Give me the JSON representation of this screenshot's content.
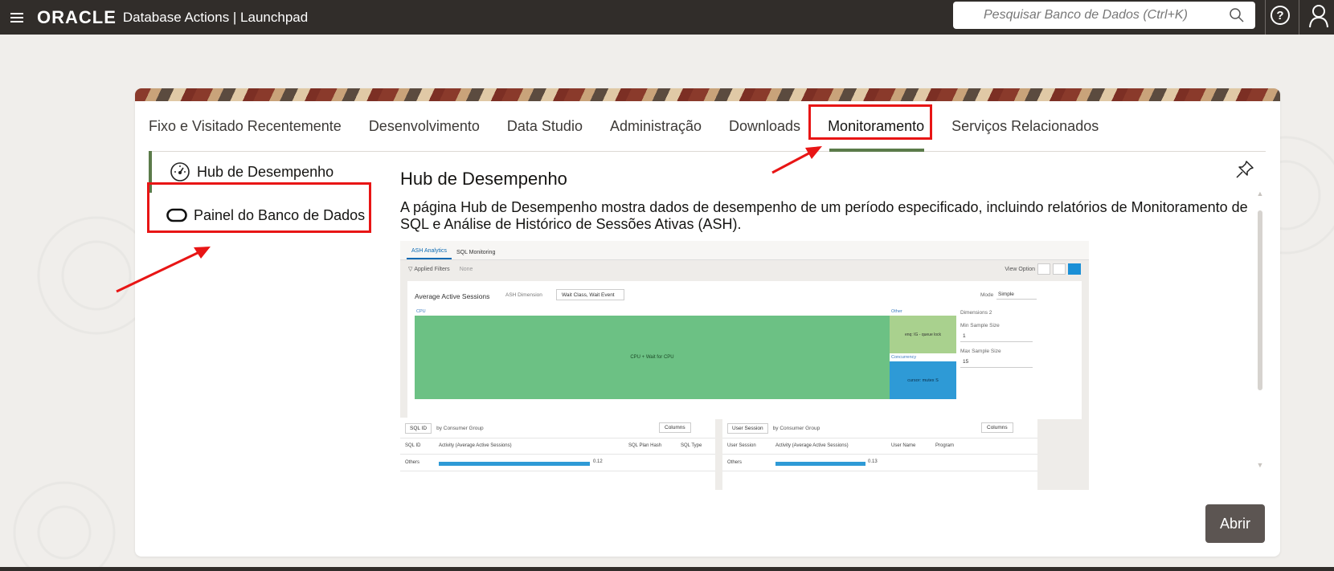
{
  "topbar": {
    "brand": "ORACLE",
    "app_title": "Database Actions | Launchpad",
    "search_placeholder": "Pesquisar Banco de Dados (Ctrl+K)",
    "help_label": "?"
  },
  "tabs": [
    {
      "label": "Fixo e Visitado Recentemente",
      "active": false
    },
    {
      "label": "Desenvolvimento",
      "active": false
    },
    {
      "label": "Data Studio",
      "active": false
    },
    {
      "label": "Administração",
      "active": false
    },
    {
      "label": "Downloads",
      "active": false
    },
    {
      "label": "Monitoramento",
      "active": true
    },
    {
      "label": "Serviços Relacionados",
      "active": false
    }
  ],
  "left_items": [
    {
      "label": "Hub de Desempenho",
      "icon": "gauge-icon",
      "selected": true
    },
    {
      "label": "Painel do Banco de Dados",
      "icon": "oval-icon",
      "selected": false
    }
  ],
  "content": {
    "title": "Hub de Desempenho",
    "description": "A página Hub de Desempenho mostra dados de desempenho de um período especificado, incluindo relatórios de Monitoramento de SQL e Análise de Histórico de Sessões Ativas (ASH)."
  },
  "preview": {
    "tabs": [
      "ASH Analytics",
      "SQL Monitoring"
    ],
    "applied_filters": "Applied Filters",
    "filters_value": "None",
    "view_option": "View Option",
    "panel_title": "Average Active Sessions",
    "ash_dimension_label": "ASH Dimension",
    "ash_dimension_value": "Wait Class, Wait Event",
    "mode_label": "Mode",
    "mode_value": "Simple",
    "dimensions_label": "Dimensions 2",
    "min_sample_label": "Min Sample Size",
    "min_sample_value": "1",
    "max_sample_label": "Max Sample Size",
    "max_sample_value": "15",
    "treemap": {
      "cpu_group": "CPU",
      "cpu_cell": "CPU + Wait for CPU",
      "other_group": "Other",
      "other_cell": "enq: IG - queue lock",
      "concurrency_group": "Concurrency",
      "concurrency_cell": "cursor: mutex S"
    },
    "left_table": {
      "select": "SQL ID",
      "by": "by Consumer Group",
      "columns_btn": "Columns",
      "headers": [
        "SQL ID",
        "Activity (Average Active Sessions)",
        "SQL Plan Hash",
        "SQL Type"
      ],
      "row_label": "Others",
      "row_value": "0.12"
    },
    "right_table": {
      "select": "User Session",
      "by": "by Consumer Group",
      "columns_btn": "Columns",
      "headers": [
        "User Session",
        "Activity (Average Active Sessions)",
        "User Name",
        "Program"
      ],
      "row_label": "Others",
      "row_value": "0.13"
    }
  },
  "open_button": "Abrir",
  "colors": {
    "topbar": "#312d2a",
    "active_tab_underline": "#5b7b4a",
    "annotation_red": "#e81515",
    "open_button": "#5c5552"
  }
}
